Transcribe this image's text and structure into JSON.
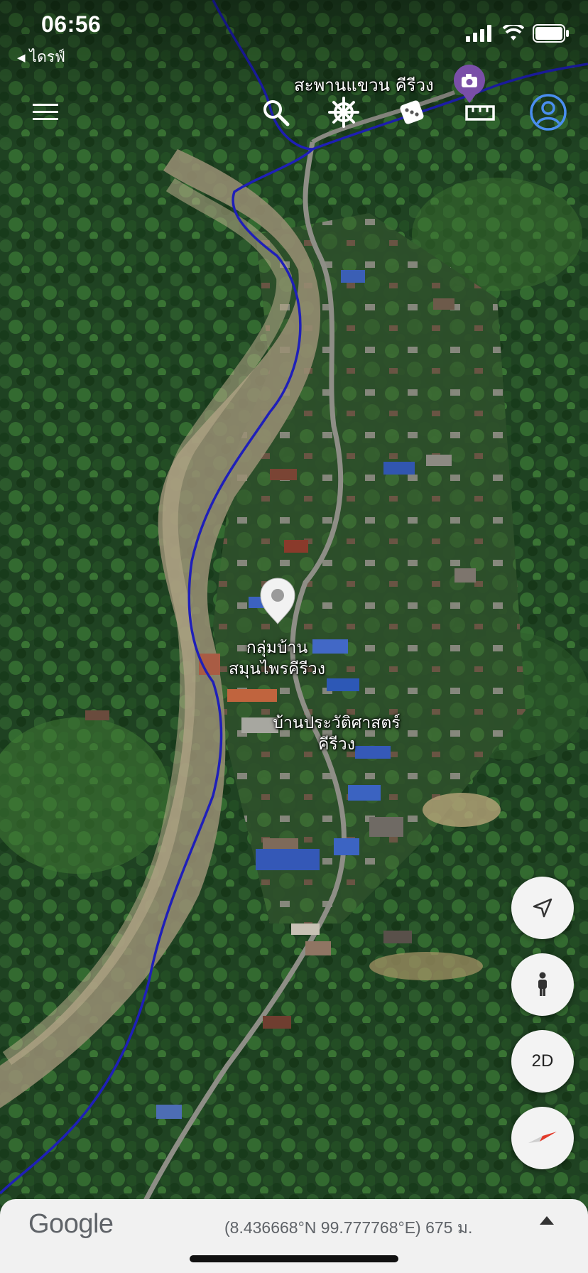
{
  "status_bar": {
    "time": "06:56",
    "back_label": "ไดรฟ์"
  },
  "toolbar": {
    "menu_icon": "menu-icon",
    "search_icon": "search-icon",
    "voyager_icon": "ships-wheel-icon",
    "feeling_lucky_icon": "dice-icon",
    "measure_icon": "ruler-icon",
    "profile_icon": "account-icon"
  },
  "map": {
    "view": "satellite 3D",
    "labels": {
      "bridge": "สะพานแขวน คีรีวง",
      "herb_group_line1": "กลุ่มบ้าน",
      "herb_group_line2": "สมุนไพรคีรีวง",
      "museum_line1": "บ้านประวัติศาสตร์",
      "museum_line2": "คีรีวง"
    },
    "river_color": "#1f1fb8",
    "photo_pin_color": "#7a4fa8"
  },
  "controls": {
    "location_icon": "navigation-arrow-icon",
    "street_view_icon": "pegman-icon",
    "toggle_2d_label": "2D",
    "compass_icon": "compass-icon"
  },
  "footer": {
    "brand": "Google",
    "coordinates": "(8.436668°N 99.777768°E) 675 ม.",
    "expand_icon": "chevron-up-icon"
  }
}
